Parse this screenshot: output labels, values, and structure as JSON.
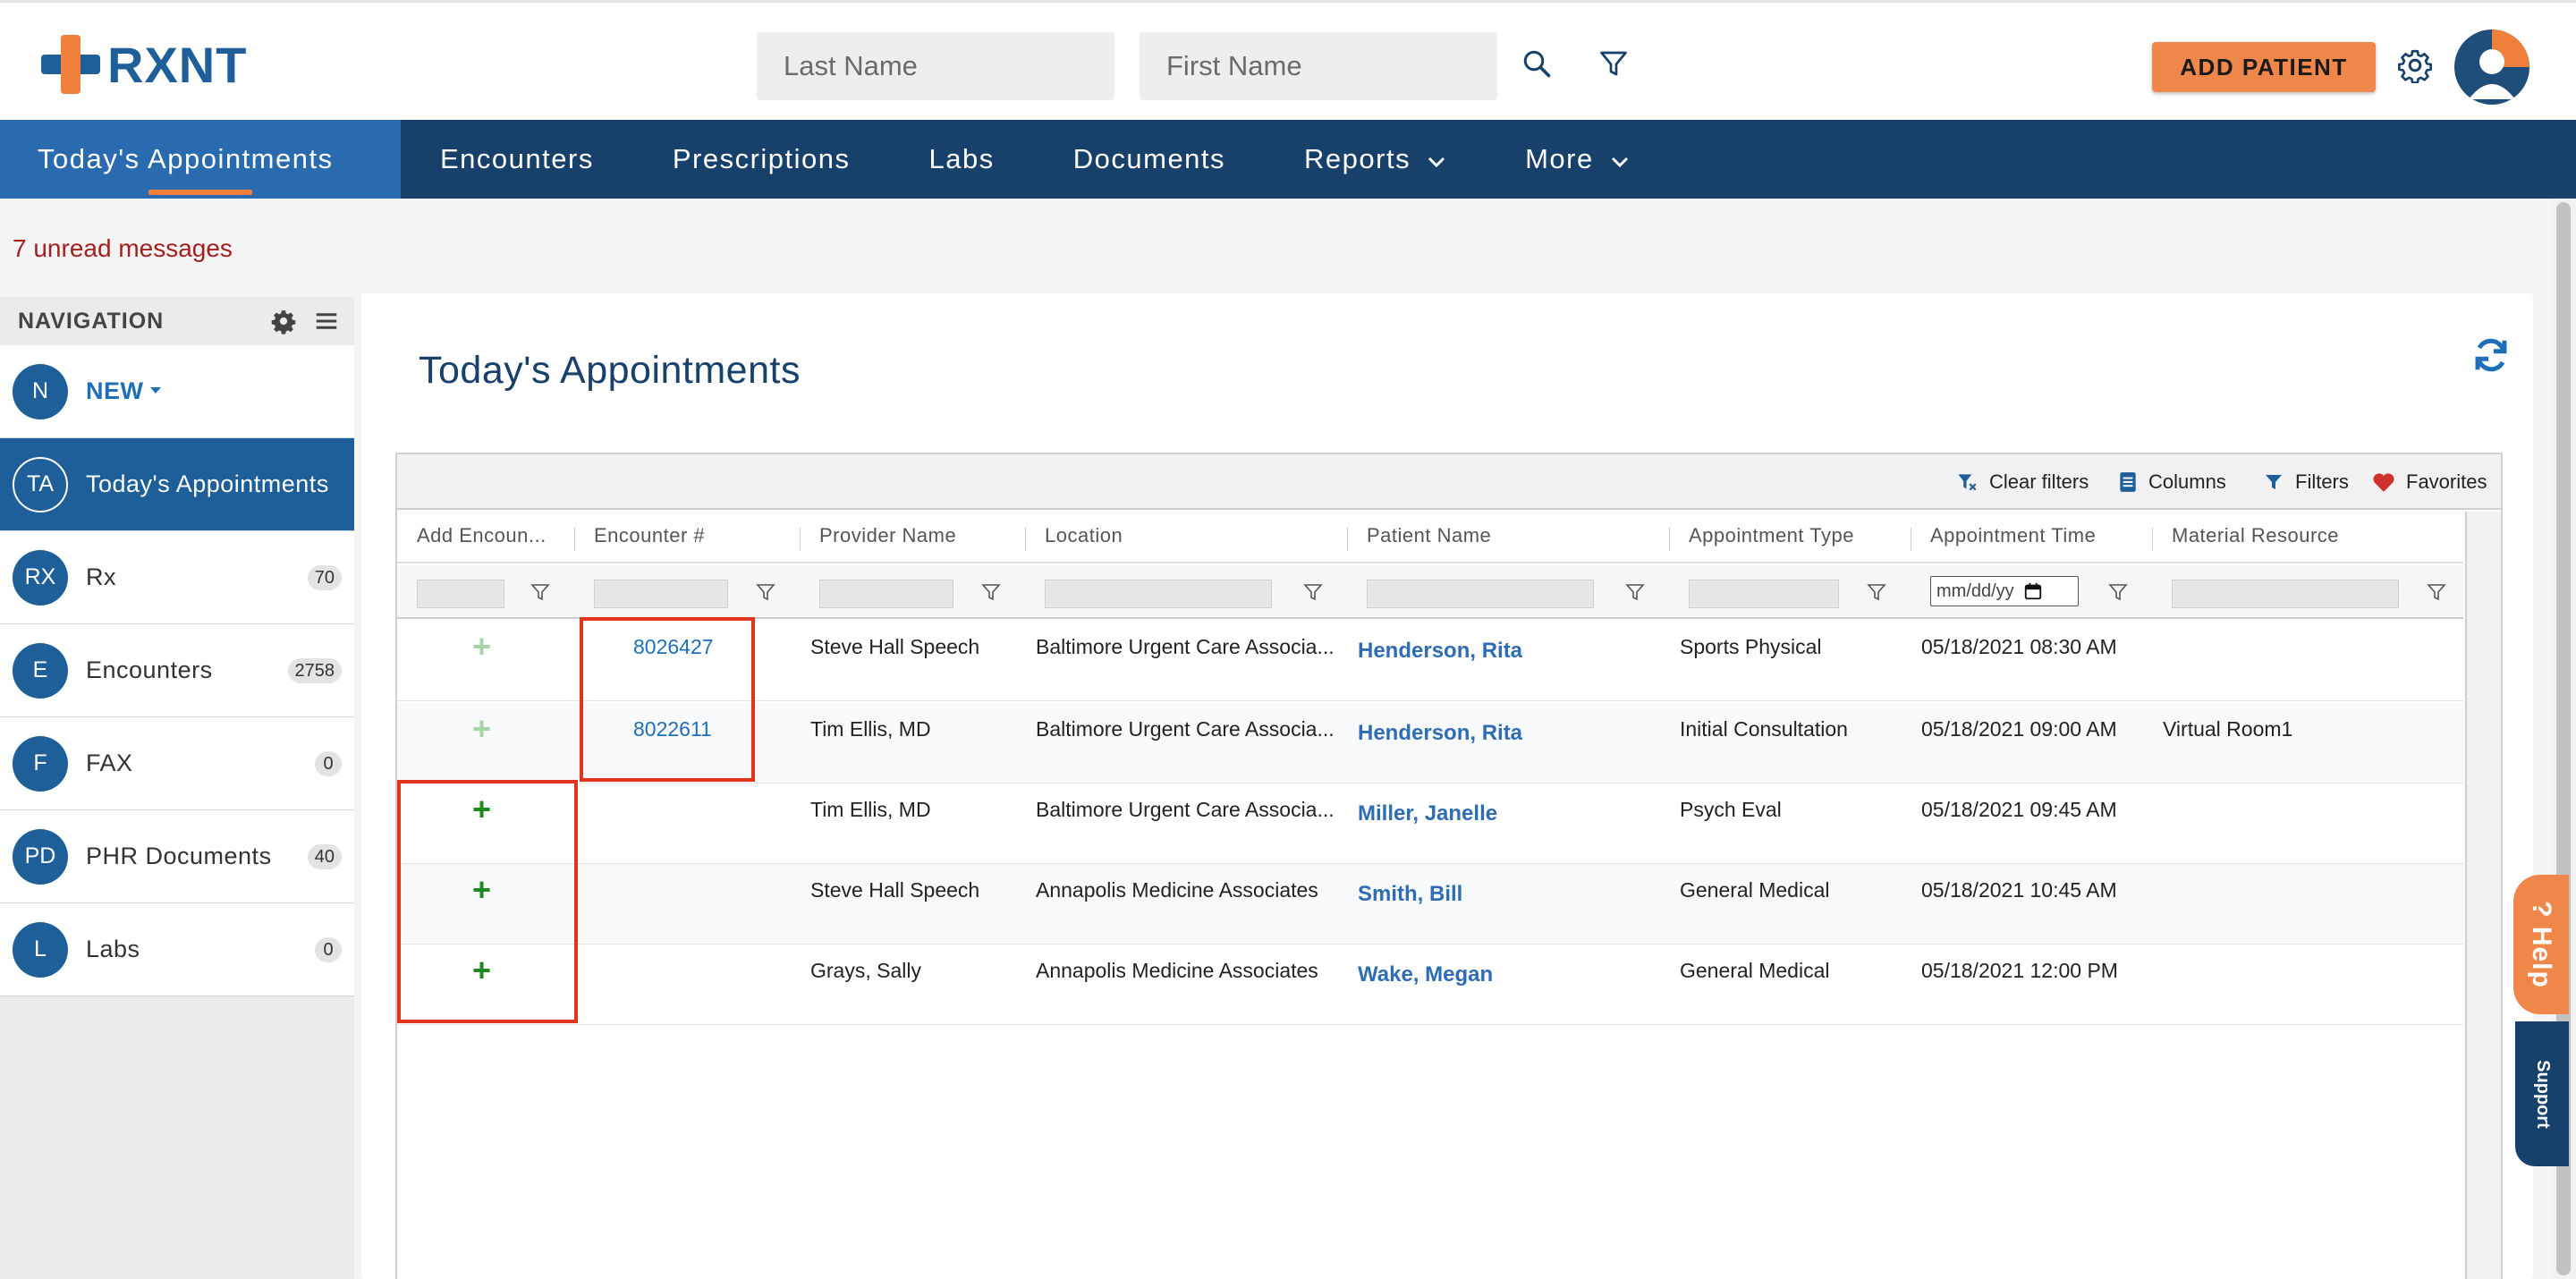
{
  "header": {
    "brand": "RXNT",
    "last_name_placeholder": "Last Name",
    "first_name_placeholder": "First Name",
    "add_patient_label": "ADD PATIENT"
  },
  "nav": {
    "tabs": [
      {
        "label": "Today's Appointments",
        "active": true
      },
      {
        "label": "Encounters"
      },
      {
        "label": "Prescriptions"
      },
      {
        "label": "Labs"
      },
      {
        "label": "Documents"
      },
      {
        "label": "Reports",
        "dropdown": true
      },
      {
        "label": "More",
        "dropdown": true
      }
    ]
  },
  "unread_messages": "7 unread messages",
  "sidebar": {
    "heading": "NAVIGATION",
    "items": [
      {
        "initials": "N",
        "label": "NEW",
        "badge": ""
      },
      {
        "initials": "TA",
        "label": "Today's Appointments",
        "badge": ""
      },
      {
        "initials": "RX",
        "label": "Rx",
        "badge": "70"
      },
      {
        "initials": "E",
        "label": "Encounters",
        "badge": "2758"
      },
      {
        "initials": "F",
        "label": "FAX",
        "badge": "0"
      },
      {
        "initials": "PD",
        "label": "PHR Documents",
        "badge": "40"
      },
      {
        "initials": "L",
        "label": "Labs",
        "badge": "0"
      }
    ]
  },
  "main": {
    "title": "Today's Appointments",
    "toolbar": {
      "clear_filters": "Clear filters",
      "columns": "Columns",
      "filters": "Filters",
      "favorites": "Favorites"
    },
    "columns": [
      "Add Encoun...",
      "Encounter #",
      "Provider Name",
      "Location",
      "Patient Name",
      "Appointment Type",
      "Appointment Time",
      "Material Resource"
    ],
    "date_filter_placeholder": "mm/dd/yy",
    "rows": [
      {
        "add": "+",
        "encounter": "8026427",
        "provider": "Steve Hall Speech",
        "location": "Baltimore Urgent Care Associa...",
        "patient": "Henderson, Rita",
        "type": "Sports Physical",
        "time": "05/18/2021 08:30 AM",
        "resource": ""
      },
      {
        "add": "+",
        "encounter": "8022611",
        "provider": "Tim Ellis, MD",
        "location": "Baltimore Urgent Care Associa...",
        "patient": "Henderson, Rita",
        "type": "Initial Consultation",
        "time": "05/18/2021 09:00 AM",
        "resource": "Virtual Room1"
      },
      {
        "add": "+",
        "encounter": "",
        "provider": "Tim Ellis, MD",
        "location": "Baltimore Urgent Care Associa...",
        "patient": "Miller, Janelle",
        "type": "Psych Eval",
        "time": "05/18/2021 09:45 AM",
        "resource": ""
      },
      {
        "add": "+",
        "encounter": "",
        "provider": "Steve Hall Speech",
        "location": "Annapolis Medicine Associates",
        "patient": "Smith, Bill",
        "type": "General Medical",
        "time": "05/18/2021 10:45 AM",
        "resource": ""
      },
      {
        "add": "+",
        "encounter": "",
        "provider": "Grays, Sally",
        "location": "Annapolis Medicine Associates",
        "patient": "Wake, Megan",
        "type": "General Medical",
        "time": "05/18/2021 12:00 PM",
        "resource": ""
      }
    ]
  },
  "help": {
    "help_label": "? Help",
    "support_label": "Support"
  },
  "colors": {
    "brand_blue": "#1f5f99",
    "brand_orange": "#f07f3c",
    "nav_dark": "#17406a",
    "highlight_red": "#e0341c"
  }
}
